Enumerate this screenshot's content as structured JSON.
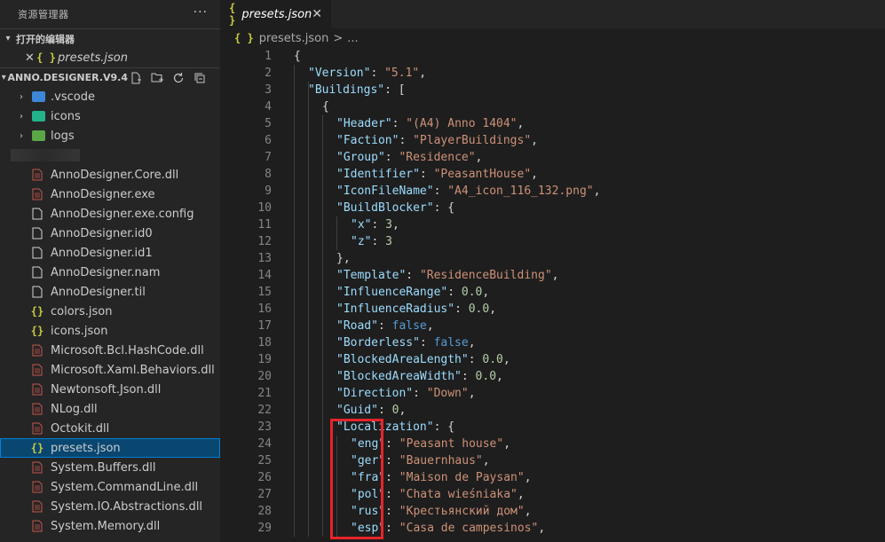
{
  "sidebar": {
    "title": "资源管理器",
    "more": "···",
    "open_editors": {
      "header": "打开的编辑器",
      "items": [
        {
          "close": "✕",
          "name": "presets.json"
        }
      ]
    },
    "project": {
      "header": "ANNO.DESIGNER.V9.4",
      "folders": [
        {
          "name": ".vscode",
          "color": "#3c87d8"
        },
        {
          "name": "icons",
          "color": "#23b28a"
        },
        {
          "name": "logs",
          "color": "#5aa845"
        }
      ],
      "files": [
        {
          "name": "AnnoDesigner.Core.dll",
          "icon": "dll"
        },
        {
          "name": "AnnoDesigner.exe",
          "icon": "dll"
        },
        {
          "name": "AnnoDesigner.exe.config",
          "icon": "doc"
        },
        {
          "name": "AnnoDesigner.id0",
          "icon": "doc"
        },
        {
          "name": "AnnoDesigner.id1",
          "icon": "doc"
        },
        {
          "name": "AnnoDesigner.nam",
          "icon": "doc"
        },
        {
          "name": "AnnoDesigner.til",
          "icon": "doc"
        },
        {
          "name": "colors.json",
          "icon": "json"
        },
        {
          "name": "icons.json",
          "icon": "json"
        },
        {
          "name": "Microsoft.Bcl.HashCode.dll",
          "icon": "dll"
        },
        {
          "name": "Microsoft.Xaml.Behaviors.dll",
          "icon": "dll"
        },
        {
          "name": "Newtonsoft.Json.dll",
          "icon": "dll"
        },
        {
          "name": "NLog.dll",
          "icon": "dll"
        },
        {
          "name": "Octokit.dll",
          "icon": "dll"
        },
        {
          "name": "presets.json",
          "icon": "json",
          "selected": true
        },
        {
          "name": "System.Buffers.dll",
          "icon": "dll"
        },
        {
          "name": "System.CommandLine.dll",
          "icon": "dll"
        },
        {
          "name": "System.IO.Abstractions.dll",
          "icon": "dll"
        },
        {
          "name": "System.Memory.dll",
          "icon": "dll"
        }
      ]
    }
  },
  "editor": {
    "tab": {
      "icon": "{ }",
      "label": "presets.json",
      "close": "✕"
    },
    "breadcrumb": {
      "icon": "{ }",
      "file": "presets.json",
      "sep": ">",
      "rest": "..."
    },
    "lines": [
      {
        "n": "1",
        "i": 0,
        "parts": [
          [
            "p",
            "{"
          ]
        ]
      },
      {
        "n": "2",
        "i": 1,
        "parts": [
          [
            "k",
            "\"Version\""
          ],
          [
            "p",
            ": "
          ],
          [
            "s",
            "\"5.1\""
          ],
          [
            "p",
            ","
          ]
        ]
      },
      {
        "n": "3",
        "i": 1,
        "parts": [
          [
            "k",
            "\"Buildings\""
          ],
          [
            "p",
            ": ["
          ]
        ]
      },
      {
        "n": "4",
        "i": 2,
        "parts": [
          [
            "p",
            "{"
          ]
        ]
      },
      {
        "n": "5",
        "i": 3,
        "parts": [
          [
            "k",
            "\"Header\""
          ],
          [
            "p",
            ": "
          ],
          [
            "s",
            "\"(A4) Anno 1404\""
          ],
          [
            "p",
            ","
          ]
        ]
      },
      {
        "n": "6",
        "i": 3,
        "parts": [
          [
            "k",
            "\"Faction\""
          ],
          [
            "p",
            ": "
          ],
          [
            "s",
            "\"PlayerBuildings\""
          ],
          [
            "p",
            ","
          ]
        ]
      },
      {
        "n": "7",
        "i": 3,
        "parts": [
          [
            "k",
            "\"Group\""
          ],
          [
            "p",
            ": "
          ],
          [
            "s",
            "\"Residence\""
          ],
          [
            "p",
            ","
          ]
        ]
      },
      {
        "n": "8",
        "i": 3,
        "parts": [
          [
            "k",
            "\"Identifier\""
          ],
          [
            "p",
            ": "
          ],
          [
            "s",
            "\"PeasantHouse\""
          ],
          [
            "p",
            ","
          ]
        ]
      },
      {
        "n": "9",
        "i": 3,
        "parts": [
          [
            "k",
            "\"IconFileName\""
          ],
          [
            "p",
            ": "
          ],
          [
            "s",
            "\"A4_icon_116_132.png\""
          ],
          [
            "p",
            ","
          ]
        ]
      },
      {
        "n": "10",
        "i": 3,
        "parts": [
          [
            "k",
            "\"BuildBlocker\""
          ],
          [
            "p",
            ": {"
          ]
        ]
      },
      {
        "n": "11",
        "i": 4,
        "parts": [
          [
            "k",
            "\"x\""
          ],
          [
            "p",
            ": "
          ],
          [
            "n",
            "3"
          ],
          [
            "p",
            ","
          ]
        ]
      },
      {
        "n": "12",
        "i": 4,
        "parts": [
          [
            "k",
            "\"z\""
          ],
          [
            "p",
            ": "
          ],
          [
            "n",
            "3"
          ]
        ]
      },
      {
        "n": "13",
        "i": 3,
        "parts": [
          [
            "p",
            "},"
          ]
        ]
      },
      {
        "n": "14",
        "i": 3,
        "parts": [
          [
            "k",
            "\"Template\""
          ],
          [
            "p",
            ": "
          ],
          [
            "s",
            "\"ResidenceBuilding\""
          ],
          [
            "p",
            ","
          ]
        ]
      },
      {
        "n": "15",
        "i": 3,
        "parts": [
          [
            "k",
            "\"InfluenceRange\""
          ],
          [
            "p",
            ": "
          ],
          [
            "n",
            "0.0"
          ],
          [
            "p",
            ","
          ]
        ]
      },
      {
        "n": "16",
        "i": 3,
        "parts": [
          [
            "k",
            "\"InfluenceRadius\""
          ],
          [
            "p",
            ": "
          ],
          [
            "n",
            "0.0"
          ],
          [
            "p",
            ","
          ]
        ]
      },
      {
        "n": "17",
        "i": 3,
        "parts": [
          [
            "k",
            "\"Road\""
          ],
          [
            "p",
            ": "
          ],
          [
            "kw",
            "false"
          ],
          [
            "p",
            ","
          ]
        ]
      },
      {
        "n": "18",
        "i": 3,
        "parts": [
          [
            "k",
            "\"Borderless\""
          ],
          [
            "p",
            ": "
          ],
          [
            "kw",
            "false"
          ],
          [
            "p",
            ","
          ]
        ]
      },
      {
        "n": "19",
        "i": 3,
        "parts": [
          [
            "k",
            "\"BlockedAreaLength\""
          ],
          [
            "p",
            ": "
          ],
          [
            "n",
            "0.0"
          ],
          [
            "p",
            ","
          ]
        ]
      },
      {
        "n": "20",
        "i": 3,
        "parts": [
          [
            "k",
            "\"BlockedAreaWidth\""
          ],
          [
            "p",
            ": "
          ],
          [
            "n",
            "0.0"
          ],
          [
            "p",
            ","
          ]
        ]
      },
      {
        "n": "21",
        "i": 3,
        "parts": [
          [
            "k",
            "\"Direction\""
          ],
          [
            "p",
            ": "
          ],
          [
            "s",
            "\"Down\""
          ],
          [
            "p",
            ","
          ]
        ]
      },
      {
        "n": "22",
        "i": 3,
        "parts": [
          [
            "k",
            "\"Guid\""
          ],
          [
            "p",
            ": "
          ],
          [
            "n",
            "0"
          ],
          [
            "p",
            ","
          ]
        ]
      },
      {
        "n": "23",
        "i": 3,
        "parts": [
          [
            "k",
            "\"Localization\""
          ],
          [
            "p",
            ": {"
          ]
        ]
      },
      {
        "n": "24",
        "i": 4,
        "parts": [
          [
            "k",
            "\"eng\""
          ],
          [
            "p",
            ": "
          ],
          [
            "s",
            "\"Peasant house\""
          ],
          [
            "p",
            ","
          ]
        ]
      },
      {
        "n": "25",
        "i": 4,
        "parts": [
          [
            "k",
            "\"ger\""
          ],
          [
            "p",
            ": "
          ],
          [
            "s",
            "\"Bauernhaus\""
          ],
          [
            "p",
            ","
          ]
        ]
      },
      {
        "n": "26",
        "i": 4,
        "parts": [
          [
            "k",
            "\"fra\""
          ],
          [
            "p",
            ": "
          ],
          [
            "s",
            "\"Maison de Paysan\""
          ],
          [
            "p",
            ","
          ]
        ]
      },
      {
        "n": "27",
        "i": 4,
        "parts": [
          [
            "k",
            "\"pol\""
          ],
          [
            "p",
            ": "
          ],
          [
            "s",
            "\"Chata wieśniaka\""
          ],
          [
            "p",
            ","
          ]
        ]
      },
      {
        "n": "28",
        "i": 4,
        "parts": [
          [
            "k",
            "\"rus\""
          ],
          [
            "p",
            ": "
          ],
          [
            "s",
            "\"Крестьянский дом\""
          ],
          [
            "p",
            ","
          ]
        ]
      },
      {
        "n": "29",
        "i": 4,
        "parts": [
          [
            "k",
            "\"esp\""
          ],
          [
            "p",
            ": "
          ],
          [
            "s",
            "\"Casa de campesinos\""
          ],
          [
            "p",
            ","
          ]
        ]
      }
    ]
  },
  "colors": {
    "selection": "#094771",
    "highlight_box": "#e5252a",
    "json_icon": "#cbcb41"
  }
}
